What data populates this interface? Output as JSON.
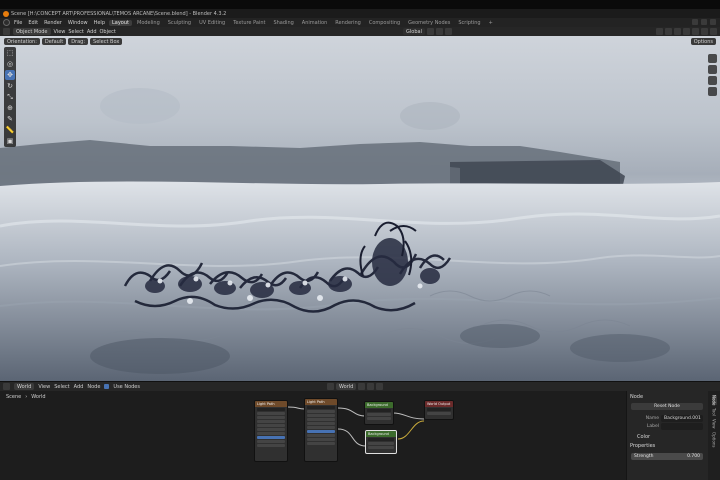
{
  "window": {
    "title": "Scene [H:\\CONCEPT ART\\PROFESSIONAL\\TEMOS ARCANE\\Scene.blend] - Blender 4.3.2"
  },
  "menubar": {
    "menus": [
      "File",
      "Edit",
      "Render",
      "Window",
      "Help"
    ],
    "workspaces": [
      "Layout",
      "Modeling",
      "Sculpting",
      "UV Editing",
      "Texture Paint",
      "Shading",
      "Animation",
      "Rendering",
      "Compositing",
      "Geometry Nodes",
      "Scripting",
      "+"
    ],
    "active_workspace": "Layout"
  },
  "viewport_header": {
    "mode": "Object Mode",
    "menus": [
      "View",
      "Select",
      "Add",
      "Object"
    ],
    "orientation": "Global",
    "options_label": "Options"
  },
  "viewport_header2": {
    "orientation_label": "Orientation:",
    "orientation_value": "Default",
    "drag_label": "Drag:",
    "drag_value": "Select Box"
  },
  "toolbar": {
    "tools": [
      {
        "name": "select-tool",
        "glyph": "⬚"
      },
      {
        "name": "cursor-tool",
        "glyph": "◎"
      },
      {
        "name": "move-tool",
        "glyph": "✥"
      },
      {
        "name": "rotate-tool",
        "glyph": "↻"
      },
      {
        "name": "scale-tool",
        "glyph": "⤡"
      },
      {
        "name": "transform-tool",
        "glyph": "⊕"
      },
      {
        "name": "annotate-tool",
        "glyph": "✎"
      },
      {
        "name": "measure-tool",
        "glyph": "📏"
      },
      {
        "name": "add-cube-tool",
        "glyph": "▣"
      }
    ],
    "active_index": 2
  },
  "node_editor": {
    "header": {
      "context": "World",
      "menus": [
        "View",
        "Select",
        "Add",
        "Node"
      ],
      "use_nodes_label": "Use Nodes",
      "datablock": "World"
    },
    "breadcrumb": [
      "Scene",
      "World"
    ],
    "nodes": [
      {
        "name": "Light Path",
        "color": "#6e4a2a"
      },
      {
        "name": "Light Path",
        "color": "#6e4a2a"
      },
      {
        "name": "Background",
        "color": "#3c6b2c"
      },
      {
        "name": "Background",
        "color": "#3c6b2c"
      },
      {
        "name": "World Output",
        "color": "#6a2a2a"
      }
    ]
  },
  "npanel": {
    "section_node": "Node",
    "reset_button": "Reset Node",
    "name_label": "Name",
    "name_value": "Background.001",
    "label_label": "Label",
    "color_label": "Color",
    "properties_label": "Properties",
    "strength_label": "Strength",
    "strength_value": "0.700",
    "tabs": [
      "Node",
      "Tool",
      "View",
      "Options"
    ]
  },
  "colors": {
    "accent": "#4772b3",
    "blender_orange": "#e87d0d"
  }
}
